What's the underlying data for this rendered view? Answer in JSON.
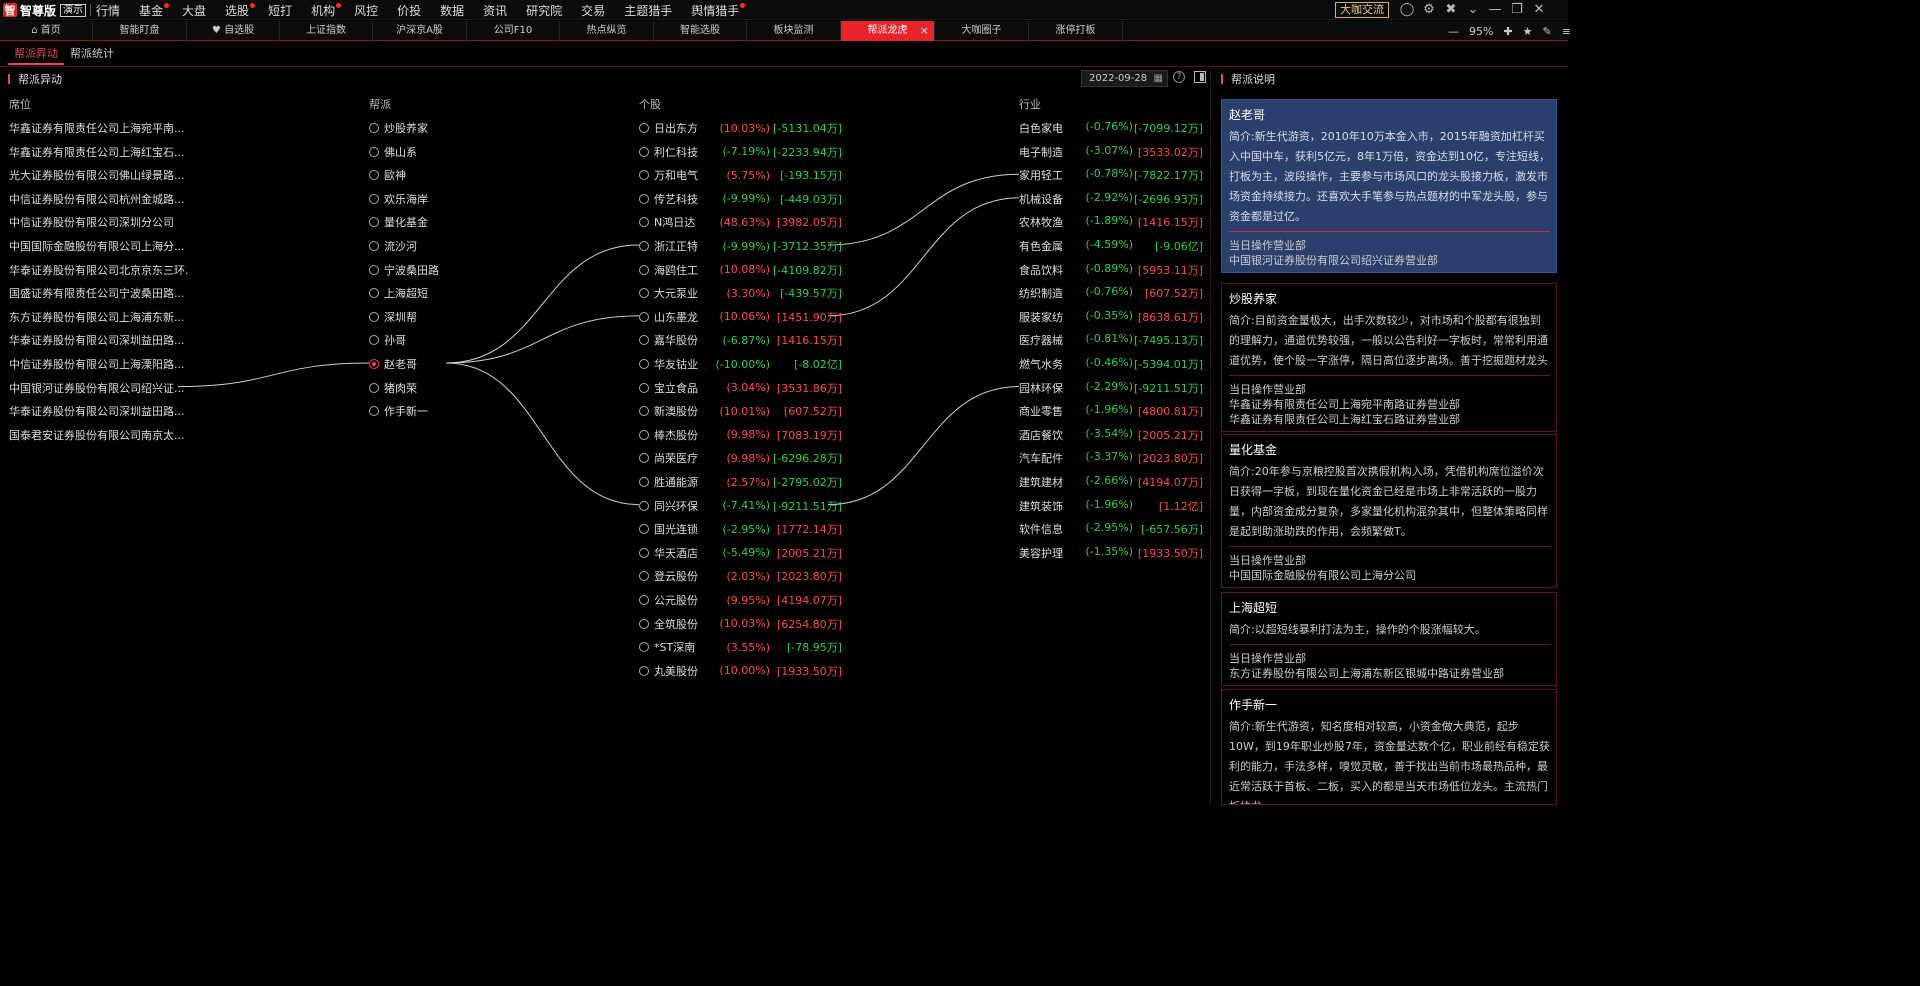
{
  "app": {
    "brand": "智尊版",
    "demo_badge": "演示",
    "logo_char": "智"
  },
  "menu": [
    {
      "label": "行情",
      "dot": false
    },
    {
      "label": "基金",
      "dot": true
    },
    {
      "label": "大盘",
      "dot": false
    },
    {
      "label": "选股",
      "dot": true
    },
    {
      "label": "短打",
      "dot": false
    },
    {
      "label": "机构",
      "dot": true
    },
    {
      "label": "风控",
      "dot": false
    },
    {
      "label": "价投",
      "dot": false
    },
    {
      "label": "数据",
      "dot": false
    },
    {
      "label": "资讯",
      "dot": false
    },
    {
      "label": "研究院",
      "dot": false
    },
    {
      "label": "交易",
      "dot": false
    },
    {
      "label": "主题猎手",
      "dot": false
    },
    {
      "label": "舆情猎手",
      "dot": true
    }
  ],
  "top_right": {
    "community_button": "大咖交流"
  },
  "tabs": [
    "首页",
    "智能盯盘",
    "自选股",
    "上证指数",
    "沪深京A股",
    "公司F10",
    "热点纵览",
    "智能选股",
    "板块监测",
    "帮派龙虎",
    "大咖圈子",
    "涨停打板"
  ],
  "active_tab": "帮派龙虎",
  "zoom": "95%",
  "subtabs": [
    "帮派异动",
    "帮派统计"
  ],
  "panel": {
    "title": "帮派异动",
    "date": "2022-09-28",
    "desc_title": "帮派说明"
  },
  "columns": {
    "seat": "席位",
    "gang": "帮派",
    "stock": "个股",
    "industry": "行业"
  },
  "seats": [
    "华鑫证券有限责任公司上海宛平南...",
    "华鑫证券有限责任公司上海红宝石...",
    "光大证券股份有限公司佛山绿景路...",
    "中信证券股份有限公司杭州金城路...",
    "中信证券股份有限公司深圳分公司",
    "中国国际金融股份有限公司上海分...",
    "华泰证券股份有限公司北京京东三环...",
    "国盛证券有限责任公司宁波桑田路...",
    "东方证券股份有限公司上海浦东新...",
    "华泰证券股份有限公司深圳益田路...",
    "中信证券股份有限公司上海溧阳路...",
    "中国银河证券股份有限公司绍兴证...",
    "华泰证券股份有限公司深圳益田路...",
    "国泰君安证券股份有限公司南京太..."
  ],
  "gangs": [
    "炒股养家",
    "佛山系",
    "歐神",
    "欢乐海岸",
    "量化基金",
    "流沙河",
    "宁波桑田路",
    "上海超短",
    "深圳帮",
    "孙哥",
    "赵老哥",
    "猪肉荣",
    "作手新一"
  ],
  "selected_gang": "赵老哥",
  "stocks": [
    {
      "name": "日出东方",
      "pct": "(10.03%)",
      "amt": "[-5131.04万]",
      "pc": "up",
      "ac": "dn"
    },
    {
      "name": "利仁科技",
      "pct": "(-7.19%)",
      "amt": "[-2233.94万]",
      "pc": "dn",
      "ac": "dn"
    },
    {
      "name": "万和电气",
      "pct": "(5.75%)",
      "amt": "[-193.15万]",
      "pc": "up",
      "ac": "dn"
    },
    {
      "name": "传艺科技",
      "pct": "(-9.99%)",
      "amt": "[-449.03万]",
      "pc": "dn",
      "ac": "dn"
    },
    {
      "name": "N鸿日达",
      "pct": "(48.63%)",
      "amt": "[3982.05万]",
      "pc": "up",
      "ac": "up"
    },
    {
      "name": "浙江正特",
      "pct": "(-9.99%)",
      "amt": "[-3712.35万]",
      "pc": "dn",
      "ac": "dn"
    },
    {
      "name": "海鸥住工",
      "pct": "(10.08%)",
      "amt": "[-4109.82万]",
      "pc": "up",
      "ac": "dn"
    },
    {
      "name": "大元泵业",
      "pct": "(3.30%)",
      "amt": "[-439.57万]",
      "pc": "up",
      "ac": "dn"
    },
    {
      "name": "山东墨龙",
      "pct": "(10.06%)",
      "amt": "[1451.90万]",
      "pc": "up",
      "ac": "up"
    },
    {
      "name": "嘉华股份",
      "pct": "(-6.87%)",
      "amt": "[1416.15万]",
      "pc": "dn",
      "ac": "up"
    },
    {
      "name": "华友钴业",
      "pct": "(-10.00%)",
      "amt": "[-8.02亿]",
      "pc": "dn",
      "ac": "dn"
    },
    {
      "name": "宝立食品",
      "pct": "(3.04%)",
      "amt": "[3531.86万]",
      "pc": "up",
      "ac": "up"
    },
    {
      "name": "新澳股份",
      "pct": "(10.01%)",
      "amt": "[607.52万]",
      "pc": "up",
      "ac": "up"
    },
    {
      "name": "棒杰股份",
      "pct": "(9.98%)",
      "amt": "[7083.19万]",
      "pc": "up",
      "ac": "up"
    },
    {
      "name": "尚荣医疗",
      "pct": "(9.98%)",
      "amt": "[-6296.28万]",
      "pc": "up",
      "ac": "dn"
    },
    {
      "name": "胜通能源",
      "pct": "(2.57%)",
      "amt": "[-2795.02万]",
      "pc": "up",
      "ac": "dn"
    },
    {
      "name": "同兴环保",
      "pct": "(-7.41%)",
      "amt": "[-9211.51万]",
      "pc": "dn",
      "ac": "dn"
    },
    {
      "name": "国光连锁",
      "pct": "(-2.95%)",
      "amt": "[1772.14万]",
      "pc": "dn",
      "ac": "up"
    },
    {
      "name": "华天酒店",
      "pct": "(-5.49%)",
      "amt": "[2005.21万]",
      "pc": "dn",
      "ac": "up"
    },
    {
      "name": "登云股份",
      "pct": "(2.03%)",
      "amt": "[2023.80万]",
      "pc": "up",
      "ac": "up"
    },
    {
      "name": "公元股份",
      "pct": "(9.95%)",
      "amt": "[4194.07万]",
      "pc": "up",
      "ac": "up"
    },
    {
      "name": "全筑股份",
      "pct": "(10.03%)",
      "amt": "[6254.80万]",
      "pc": "up",
      "ac": "up"
    },
    {
      "name": "*ST深南",
      "pct": "(3.55%)",
      "amt": "[-78.95万]",
      "pc": "up",
      "ac": "dn"
    },
    {
      "name": "丸美股份",
      "pct": "(10.00%)",
      "amt": "[1933.50万]",
      "pc": "up",
      "ac": "up"
    }
  ],
  "industries": [
    {
      "name": "白色家电",
      "pct": "(-0.76%)",
      "amt": "[-7099.12万]",
      "pc": "dn",
      "ac": "dn"
    },
    {
      "name": "电子制造",
      "pct": "(-3.07%)",
      "amt": "[3533.02万]",
      "pc": "dn",
      "ac": "up"
    },
    {
      "name": "家用轻工",
      "pct": "(-0.78%)",
      "amt": "[-7822.17万]",
      "pc": "dn",
      "ac": "dn"
    },
    {
      "name": "机械设备",
      "pct": "(-2.92%)",
      "amt": "[-2696.93万]",
      "pc": "dn",
      "ac": "dn"
    },
    {
      "name": "农林牧渔",
      "pct": "(-1.89%)",
      "amt": "[1416.15万]",
      "pc": "dn",
      "ac": "up"
    },
    {
      "name": "有色金属",
      "pct": "(-4.59%)",
      "amt": "[-9.06亿]",
      "pc": "dn",
      "ac": "dn"
    },
    {
      "name": "食品饮料",
      "pct": "(-0.89%)",
      "amt": "[5953.11万]",
      "pc": "dn",
      "ac": "up"
    },
    {
      "name": "纺织制造",
      "pct": "(-0.76%)",
      "amt": "[607.52万]",
      "pc": "dn",
      "ac": "up"
    },
    {
      "name": "服装家纺",
      "pct": "(-0.35%)",
      "amt": "[8638.61万]",
      "pc": "dn",
      "ac": "up"
    },
    {
      "name": "医疗器械",
      "pct": "(-0.81%)",
      "amt": "[-7495.13万]",
      "pc": "dn",
      "ac": "dn"
    },
    {
      "name": "燃气水务",
      "pct": "(-0.46%)",
      "amt": "[-5394.01万]",
      "pc": "dn",
      "ac": "dn"
    },
    {
      "name": "园林环保",
      "pct": "(-2.29%)",
      "amt": "[-9211.51万]",
      "pc": "dn",
      "ac": "dn"
    },
    {
      "name": "商业零售",
      "pct": "(-1.96%)",
      "amt": "[4800.81万]",
      "pc": "dn",
      "ac": "up"
    },
    {
      "name": "酒店餐饮",
      "pct": "(-3.54%)",
      "amt": "[2005.21万]",
      "pc": "dn",
      "ac": "up"
    },
    {
      "name": "汽车配件",
      "pct": "(-3.37%)",
      "amt": "[2023.80万]",
      "pc": "dn",
      "ac": "up"
    },
    {
      "name": "建筑建材",
      "pct": "(-2.66%)",
      "amt": "[4194.07万]",
      "pc": "dn",
      "ac": "up"
    },
    {
      "name": "建筑装饰",
      "pct": "(-1.96%)",
      "amt": "[1.12亿]",
      "pc": "dn",
      "ac": "up"
    },
    {
      "name": "软件信息",
      "pct": "(-2.95%)",
      "amt": "[-657.56万]",
      "pc": "dn",
      "ac": "dn"
    },
    {
      "name": "美容护理",
      "pct": "(-1.35%)",
      "amt": "[1933.50万]",
      "pc": "dn",
      "ac": "up"
    }
  ],
  "descriptions": [
    {
      "name": "赵老哥",
      "text": "简介:新生代游资，2010年10万本金入市，2015年融资加杠杆买入中国中车，获利5亿元，8年1万倍，资金达到10亿，专注短线，打板为主，波段操作，主要参与市场风口的龙头股接力板，激发市场资金持续接力。还喜欢大手笔参与热点题材的中军龙头股，参与资金都是过亿。",
      "label": "当日操作营业部",
      "depts": [
        "中国银河证券股份有限公司绍兴证券营业部"
      ],
      "active": true
    },
    {
      "name": "炒股养家",
      "text": "简介:目前资金量极大，出手次数较少，对市场和个股都有很独到的理解力，通道优势较强，一般以公告利好一字板时，常常利用通道优势，使个股一字涨停，隔日高位逐步离场。善于挖掘题材龙头",
      "label": "当日操作营业部",
      "depts": [
        "华鑫证券有限责任公司上海宛平南路证券营业部",
        "华鑫证券有限责任公司上海红宝石路证券营业部"
      ],
      "active": false
    },
    {
      "name": "量化基金",
      "text": "简介:20年参与京粮控股首次携假机构入场，凭借机构席位溢价次日获得一字板，到现在量化资金已经是市场上非常活跃的一股力量，内部资金成分复杂，多家量化机构混杂其中，但整体策略同样是起到助涨助跌的作用，会频繁做T。",
      "label": "当日操作营业部",
      "depts": [
        "中国国际金融股份有限公司上海分公司"
      ],
      "active": false
    },
    {
      "name": "上海超短",
      "text": "简介:以超短线暴利打法为主，操作的个股涨幅较大。",
      "label": "当日操作营业部",
      "depts": [
        "东方证券股份有限公司上海浦东新区银城中路证券营业部"
      ],
      "active": false
    },
    {
      "name": "作手新一",
      "text": "简介:新生代游资，知名度相对较高，小资金做大典范，起步10W，到19年职业炒股7年，资金量达数个亿，职业前经有稳定获利的能力，手法多样，嗅觉灵敏，善于找出当前市场最热品种，最近常活跃于首板、二板，买入的都是当天市场低位龙头。主流热门板块龙",
      "label": "",
      "depts": [],
      "active": false
    }
  ],
  "colors": {
    "up": "#ff4a4a",
    "down": "#2dd04a",
    "active_tab": "#e8232a",
    "accent": "#e34a4a"
  }
}
